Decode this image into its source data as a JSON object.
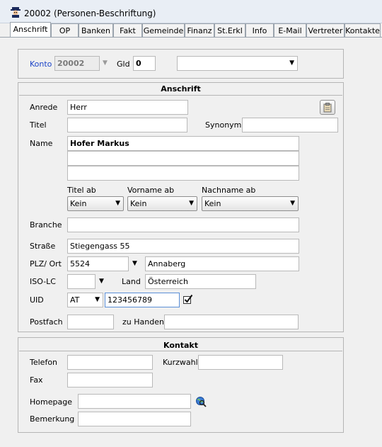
{
  "window": {
    "title": "20002  (Personen-Beschriftung)"
  },
  "tabs": [
    "Anschrift",
    "OP",
    "Banken",
    "Fakt",
    "Gemeinde",
    "Finanz",
    "St.Erkl",
    "Info",
    "E-Mail",
    "Vertreter",
    "Kontakte"
  ],
  "konto": {
    "label": "Konto",
    "value": "20002",
    "gld_label": "Gld",
    "gld_value": "0",
    "select_value": ""
  },
  "anschrift": {
    "title": "Anschrift",
    "anrede_label": "Anrede",
    "anrede": "Herr",
    "titel_label": "Titel",
    "titel": "",
    "synonym_label": "Synonym",
    "synonym": "",
    "name_label": "Name",
    "name1": "Hofer Markus",
    "name2": "",
    "name3": "",
    "titel_ab_label": "Titel ab",
    "titel_ab": "Kein",
    "vorname_ab_label": "Vorname ab",
    "vorname_ab": "Kein",
    "nachname_ab_label": "Nachname ab",
    "nachname_ab": "Kein",
    "branche_label": "Branche",
    "branche": "",
    "strasse_label": "Straße",
    "strasse": "Stiegengass 55",
    "plz_label": "PLZ/ Ort",
    "plz": "5524",
    "ort": "Annaberg",
    "iso_label": "ISO-LC",
    "iso": "",
    "land_label": "Land",
    "land": "Österreich",
    "uid_label": "UID",
    "uid_country": "AT",
    "uid": "123456789",
    "postfach_label": "Postfach",
    "postfach": "",
    "zu_handen_label": "zu Handen",
    "zu_handen": ""
  },
  "kontakt": {
    "title": "Kontakt",
    "telefon_label": "Telefon",
    "telefon": "",
    "kurzwahl_label": "Kurzwahl",
    "kurzwahl": "",
    "fax_label": "Fax",
    "fax": "",
    "homepage_label": "Homepage",
    "homepage": "",
    "bemerkung_label": "Bemerkung",
    "bemerkung": ""
  }
}
